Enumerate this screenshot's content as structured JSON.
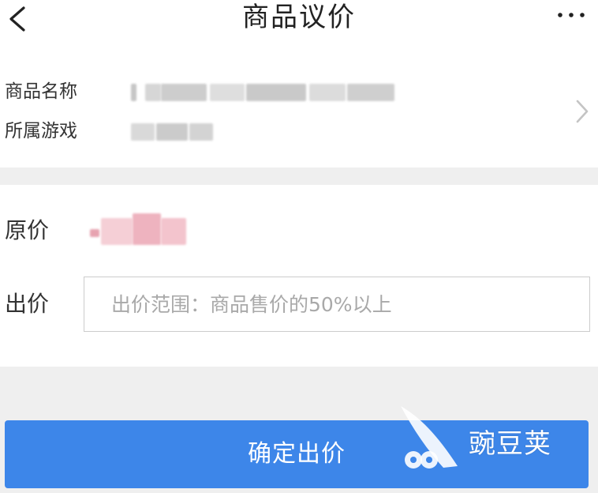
{
  "header": {
    "title": "商品议价",
    "back_icon": "chevron-left-icon",
    "more_icon": "more-horizontal-icon"
  },
  "product": {
    "name_label": "商品名称",
    "game_label": "所属游戏",
    "chevron_icon": "chevron-right-icon"
  },
  "pricing": {
    "original_label": "原价",
    "offer_label": "出价",
    "offer_placeholder": "出价范围：商品售价的50%以上",
    "offer_value": ""
  },
  "actions": {
    "confirm_label": "确定出价"
  },
  "watermark": {
    "text": "豌豆荚"
  },
  "colors": {
    "primary_button": "#3d86e9",
    "section_gray": "#efefef",
    "blurred_original_price": "#f2b8c2"
  }
}
